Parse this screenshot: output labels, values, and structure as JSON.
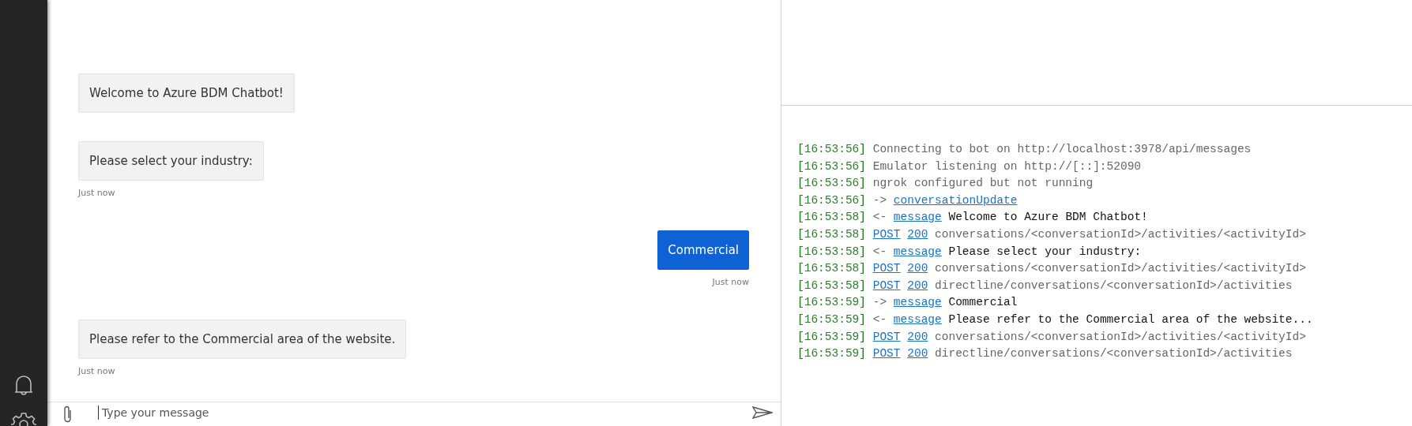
{
  "chat": {
    "messages": [
      {
        "kind": "bot",
        "text": "Welcome to Azure BDM Chatbot!"
      },
      {
        "kind": "bot",
        "text": "Please select your industry:",
        "timestamp": "Just now"
      },
      {
        "kind": "user",
        "text": "Commercial",
        "timestamp": "Just now"
      },
      {
        "kind": "bot",
        "text": "Please refer to the Commercial area of the website.",
        "timestamp": "Just now"
      }
    ],
    "input": {
      "placeholder": "Type your message"
    }
  },
  "log": [
    {
      "kind": "info",
      "time": "[16:53:56]",
      "text": "Connecting to bot on http://localhost:3978/api/messages"
    },
    {
      "kind": "info",
      "time": "[16:53:56]",
      "text": "Emulator listening on http://[::]:52090"
    },
    {
      "kind": "info",
      "time": "[16:53:56]",
      "text": "ngrok configured but not running"
    },
    {
      "kind": "message",
      "time": "[16:53:56]",
      "arrow": "->",
      "links": [
        "conversationUpdate"
      ]
    },
    {
      "kind": "message",
      "time": "[16:53:58]",
      "arrow": "<-",
      "links": [
        "message"
      ],
      "text": "Welcome to Azure BDM Chatbot!"
    },
    {
      "kind": "request",
      "time": "[16:53:58]",
      "links": [
        "POST",
        "200"
      ],
      "text": "conversations/<conversationId>/activities/<activityId>"
    },
    {
      "kind": "message",
      "time": "[16:53:58]",
      "arrow": "<-",
      "links": [
        "message"
      ],
      "text": "Please select your industry:"
    },
    {
      "kind": "request",
      "time": "[16:53:58]",
      "links": [
        "POST",
        "200"
      ],
      "text": "conversations/<conversationId>/activities/<activityId>"
    },
    {
      "kind": "request",
      "time": "[16:53:58]",
      "links": [
        "POST",
        "200"
      ],
      "text": "directline/conversations/<conversationId>/activities"
    },
    {
      "kind": "message",
      "time": "[16:53:59]",
      "arrow": "->",
      "links": [
        "message"
      ],
      "text": "Commercial"
    },
    {
      "kind": "message",
      "time": "[16:53:59]",
      "arrow": "<-",
      "links": [
        "message"
      ],
      "text": "Please refer to the Commercial area of the website..."
    },
    {
      "kind": "request",
      "time": "[16:53:59]",
      "links": [
        "POST",
        "200"
      ],
      "text": "conversations/<conversationId>/activities/<activityId>"
    },
    {
      "kind": "request",
      "time": "[16:53:59]",
      "links": [
        "POST",
        "200"
      ],
      "text": "directline/conversations/<conversationId>/activities"
    }
  ]
}
